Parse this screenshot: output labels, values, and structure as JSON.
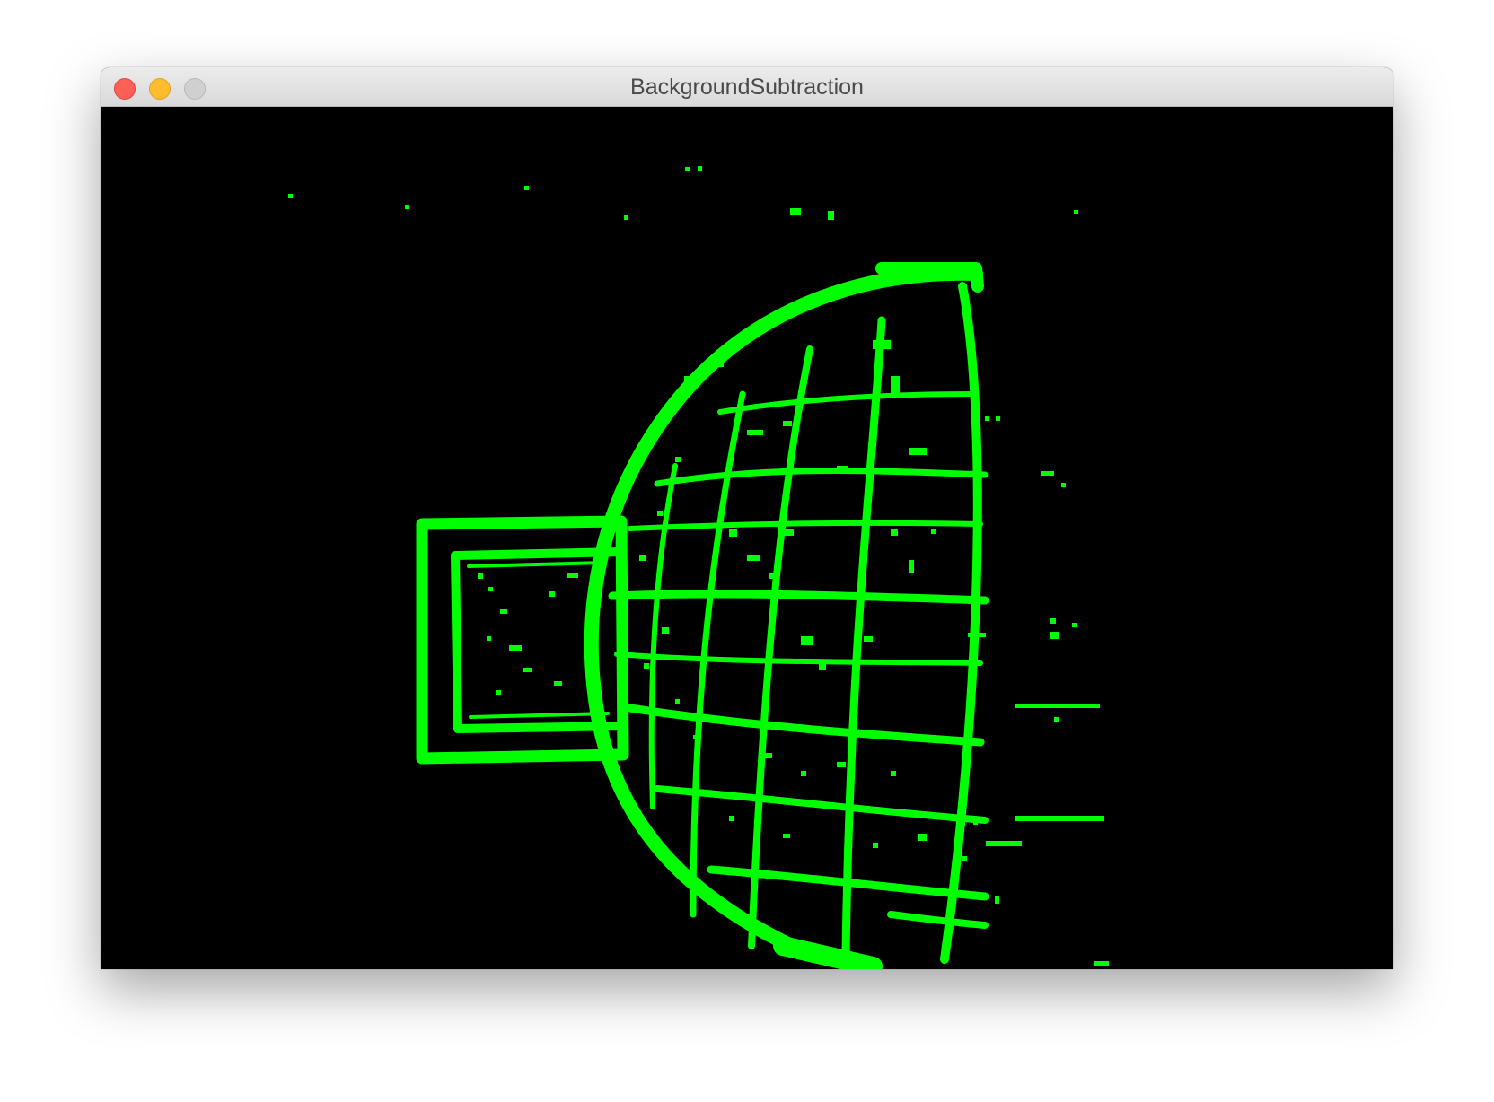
{
  "window": {
    "title": "BackgroundSubtraction",
    "controls": {
      "close": "close-button",
      "minimize": "minimize-button",
      "zoom": "zoom-button"
    }
  },
  "canvas": {
    "background_color": "#000000",
    "foreground_color": "#00ff00",
    "content": "foreground mask"
  }
}
